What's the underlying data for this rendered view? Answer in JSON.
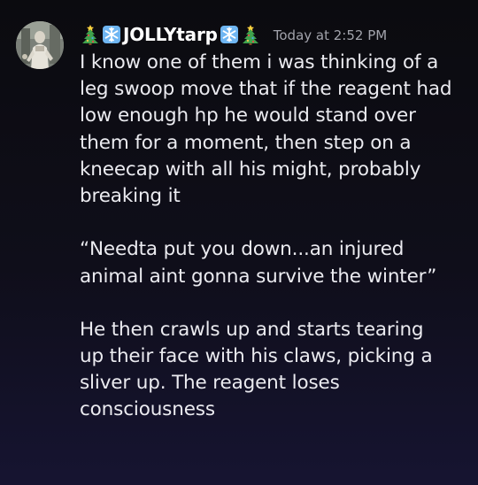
{
  "message": {
    "author": {
      "emoji_left": "christmas-tree-icon",
      "emoji_snow": "snowflake-icon",
      "username": "JOLLYtarp",
      "emoji_right": "christmas-tree-icon"
    },
    "timestamp": "Today at 2:52 PM",
    "paragraphs": [
      {
        "lines": [
          "I know one of them i was thinking of a",
          "leg swoop move that if the reagent had",
          "low enough hp he would stand over",
          "them for a moment, then step on a",
          "kneecap with all his might, probably",
          "breaking it"
        ]
      },
      {
        "lines": [
          "“Needta put you down...an injured",
          "animal aint gonna survive the winter”"
        ]
      },
      {
        "lines": [
          "He then crawls up and starts tearing",
          "up their face with his claws, picking a",
          "sliver up. The reagent loses",
          "consciousness"
        ]
      }
    ]
  },
  "colors": {
    "background_top": "#0b0b0f",
    "background_bottom": "#161431",
    "text": "#ebebf0",
    "username": "#ffffff",
    "timestamp": "#a2a3ab",
    "snowflake": "#7fc4ff",
    "tree": "#3fa34d"
  }
}
